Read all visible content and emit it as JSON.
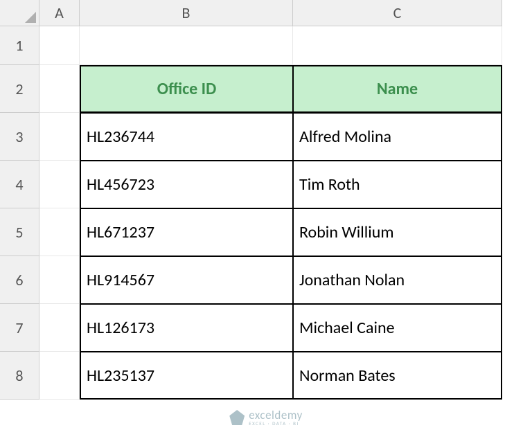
{
  "columns": [
    "A",
    "B",
    "C"
  ],
  "rows": [
    "1",
    "2",
    "3",
    "4",
    "5",
    "6",
    "7",
    "8"
  ],
  "table": {
    "headers": [
      "Office ID",
      "Name"
    ],
    "data": [
      {
        "id": "HL236744",
        "name": "Alfred Molina"
      },
      {
        "id": "HL456723",
        "name": "Tim Roth"
      },
      {
        "id": "HL671237",
        "name": "Robin Willium"
      },
      {
        "id": "HL914567",
        "name": "Jonathan Nolan"
      },
      {
        "id": "HL126173",
        "name": "Michael Caine"
      },
      {
        "id": "HL235137",
        "name": "Norman Bates"
      }
    ]
  },
  "watermark": {
    "main": "exceldemy",
    "sub": "EXCEL · DATA · BI"
  }
}
